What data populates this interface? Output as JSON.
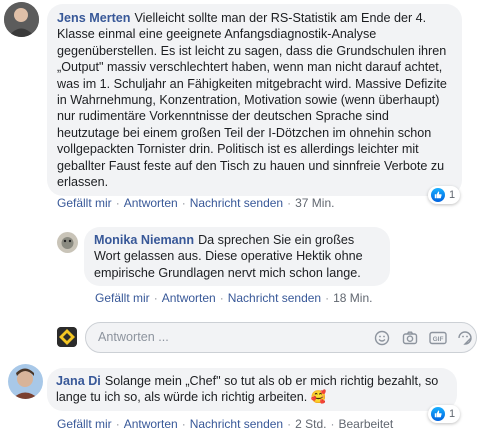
{
  "comments": [
    {
      "author": "Jens Merten",
      "text": "Vielleicht sollte man der RS-Statistik am Ende der 4. Klasse einmal eine geeignete Anfangsdiagnostik-Analyse gegenüberstellen. Es ist leicht zu sagen, dass die Grundschulen ihren „Output\" massiv verschlechtert haben, wenn man nicht darauf achtet, was im 1. Schuljahr an Fähigkeiten mitgebracht wird. Massive Defizite in Wahrnehmung, Konzentration, Motivation sowie (wenn überhaupt) nur rudimentäre Vorkenntnisse der deutschen Sprache sind heutzutage bei einem großen Teil der I-Dötzchen im ohnehin schon vollgepackten Tornister drin. Politisch ist es allerdings leichter mit geballter Faust feste auf den Tisch zu hauen und sinnfreie Verbote zu erlassen.",
      "actions": {
        "like": "Gefällt mir",
        "reply": "Antworten",
        "message": "Nachricht senden",
        "time": "37 Min."
      },
      "reactions": "1"
    },
    {
      "author": "Monika Niemann",
      "text": "Da sprechen Sie ein großes Wort gelassen aus. Diese operative Hektik ohne empirische Grundlagen nervt mich schon lange.",
      "actions": {
        "like": "Gefällt mir",
        "reply": "Antworten",
        "message": "Nachricht senden",
        "time": "18 Min."
      }
    },
    {
      "author": "Jana Di",
      "text": "Solange mein „Chef\" so tut als ob er mich richtig bezahlt, so lange tu ich so, als würde ich richtig arbeiten.",
      "emoji": "🥰",
      "actions": {
        "like": "Gefällt mir",
        "reply": "Antworten",
        "message": "Nachricht senden",
        "time": "2 Std.",
        "edited": "Bearbeitet"
      },
      "reactions": "1"
    }
  ],
  "reply_box": {
    "placeholder": "Antworten ..."
  },
  "icons": [
    "thumbs-up-icon",
    "emoji-icon",
    "camera-icon",
    "gif-icon",
    "sticker-icon"
  ],
  "colors": {
    "link": "#385898",
    "bubble": "#f2f3f5",
    "like": "#1877f2"
  }
}
